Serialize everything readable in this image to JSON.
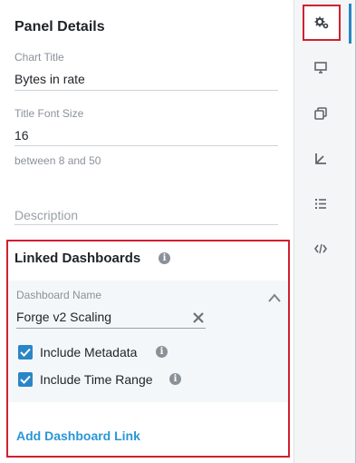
{
  "panel": {
    "title": "Panel Details",
    "chart_title": {
      "label": "Chart Title",
      "value": "Bytes in rate"
    },
    "title_font_size": {
      "label": "Title Font Size",
      "value": "16",
      "helper": "between 8 and 50"
    },
    "description": {
      "placeholder": "Description"
    }
  },
  "linked_dashboards": {
    "title": "Linked Dashboards",
    "dashboard_name": {
      "label": "Dashboard Name",
      "value": "Forge v2 Scaling"
    },
    "include_metadata": {
      "label": "Include Metadata",
      "checked": true
    },
    "include_time_range": {
      "label": "Include Time Range",
      "checked": true
    },
    "add_link_label": "Add Dashboard Link"
  },
  "sidebar": {
    "items": [
      {
        "icon": "gears-icon",
        "active": true
      },
      {
        "icon": "monitor-icon",
        "active": false
      },
      {
        "icon": "copy-icon",
        "active": false
      },
      {
        "icon": "axis-icon",
        "active": false
      },
      {
        "icon": "list-icon",
        "active": false
      },
      {
        "icon": "code-icon",
        "active": false
      }
    ]
  },
  "colors": {
    "accent": "#2a86c6",
    "link": "#2a96d6",
    "highlight_outline": "#d0202f"
  }
}
